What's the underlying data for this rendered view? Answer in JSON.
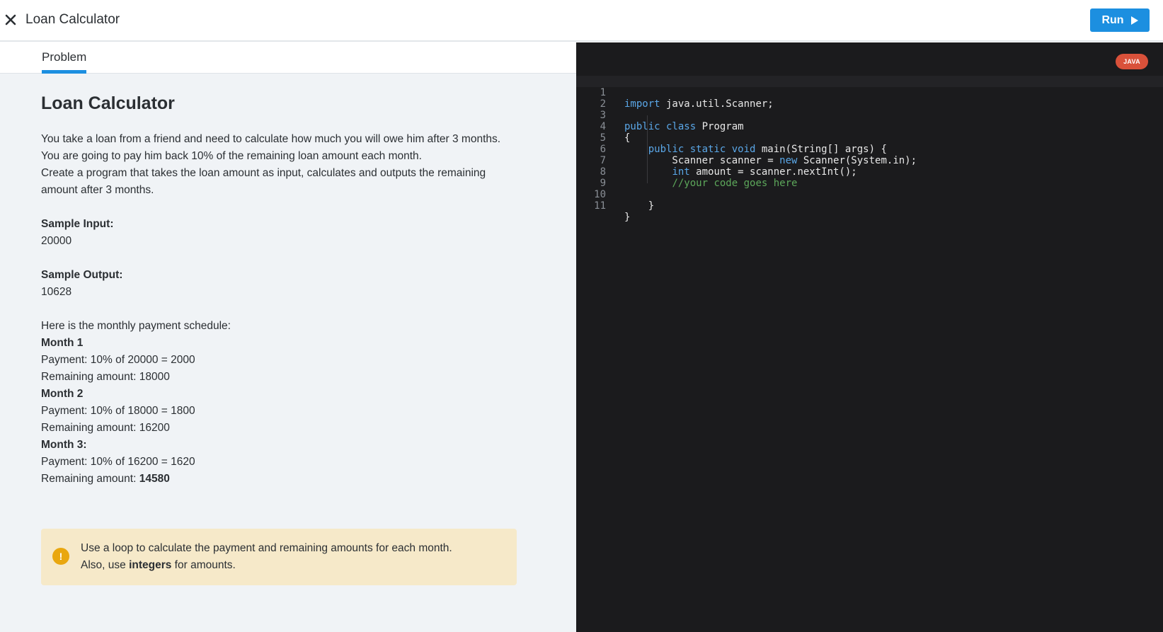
{
  "header": {
    "title": "Loan Calculator",
    "run_label": "Run"
  },
  "tabs": [
    {
      "label": "Problem",
      "active": true
    }
  ],
  "problem": {
    "title": "Loan Calculator",
    "paragraphs": [
      "You take a loan from a friend and need to calculate how much you will owe him after 3 months.",
      "You are going to pay him back 10% of the remaining loan amount each month.",
      "Create a program that takes the loan amount as input, calculates and outputs the remaining amount after 3 months."
    ],
    "sample_input_label": "Sample Input:",
    "sample_input": "20000",
    "sample_output_label": "Sample Output:",
    "sample_output": "10628",
    "schedule_intro": "Here is the monthly payment schedule:",
    "months": [
      {
        "label": "Month 1",
        "payment": "Payment: 10% of 20000 = 2000",
        "remaining": "Remaining amount: 18000"
      },
      {
        "label": "Month 2",
        "payment": "Payment: 10% of 18000 = 1800",
        "remaining": "Remaining amount: 16200"
      },
      {
        "label": "Month 3:",
        "payment": "Payment: 10% of 16200 = 1620",
        "remaining_prefix": "Remaining amount: ",
        "remaining_value": "14580"
      }
    ],
    "note": {
      "icon": "!",
      "line1": "Use a loop to calculate the payment and remaining amounts for each month.",
      "line2_prefix": "Also, use ",
      "line2_bold": "integers",
      "line2_suffix": " for amounts."
    }
  },
  "editor": {
    "language_badge": "JAVA",
    "line_numbers": [
      "1",
      "2",
      "3",
      "4",
      "5",
      "6",
      "7",
      "8",
      "9",
      "10",
      "11"
    ],
    "code": {
      "l1_kw": "import",
      "l1_rest": " java.util.Scanner;",
      "l3_kw": "public class",
      "l3_rest": " Program",
      "l4": "{",
      "l5_indent": "    ",
      "l5_kw": "public static void",
      "l5_rest": " main(String[] args) {",
      "l6_text": "        Scanner scanner = ",
      "l6_kw": "new",
      "l6_rest": " Scanner(System.in);",
      "l7_indent": "        ",
      "l7_kw": "int",
      "l7_rest": " amount = scanner.nextInt();",
      "l8_indent": "        ",
      "l8_comment": "//your code goes here",
      "l10": "    }",
      "l11": "}"
    }
  },
  "colors": {
    "accent": "#1c8fe0",
    "badge": "#d9513a",
    "note_bg": "#f6e9c9",
    "warn": "#e9a70f",
    "keyword": "#5aa7e8",
    "comment": "#5da85b"
  }
}
